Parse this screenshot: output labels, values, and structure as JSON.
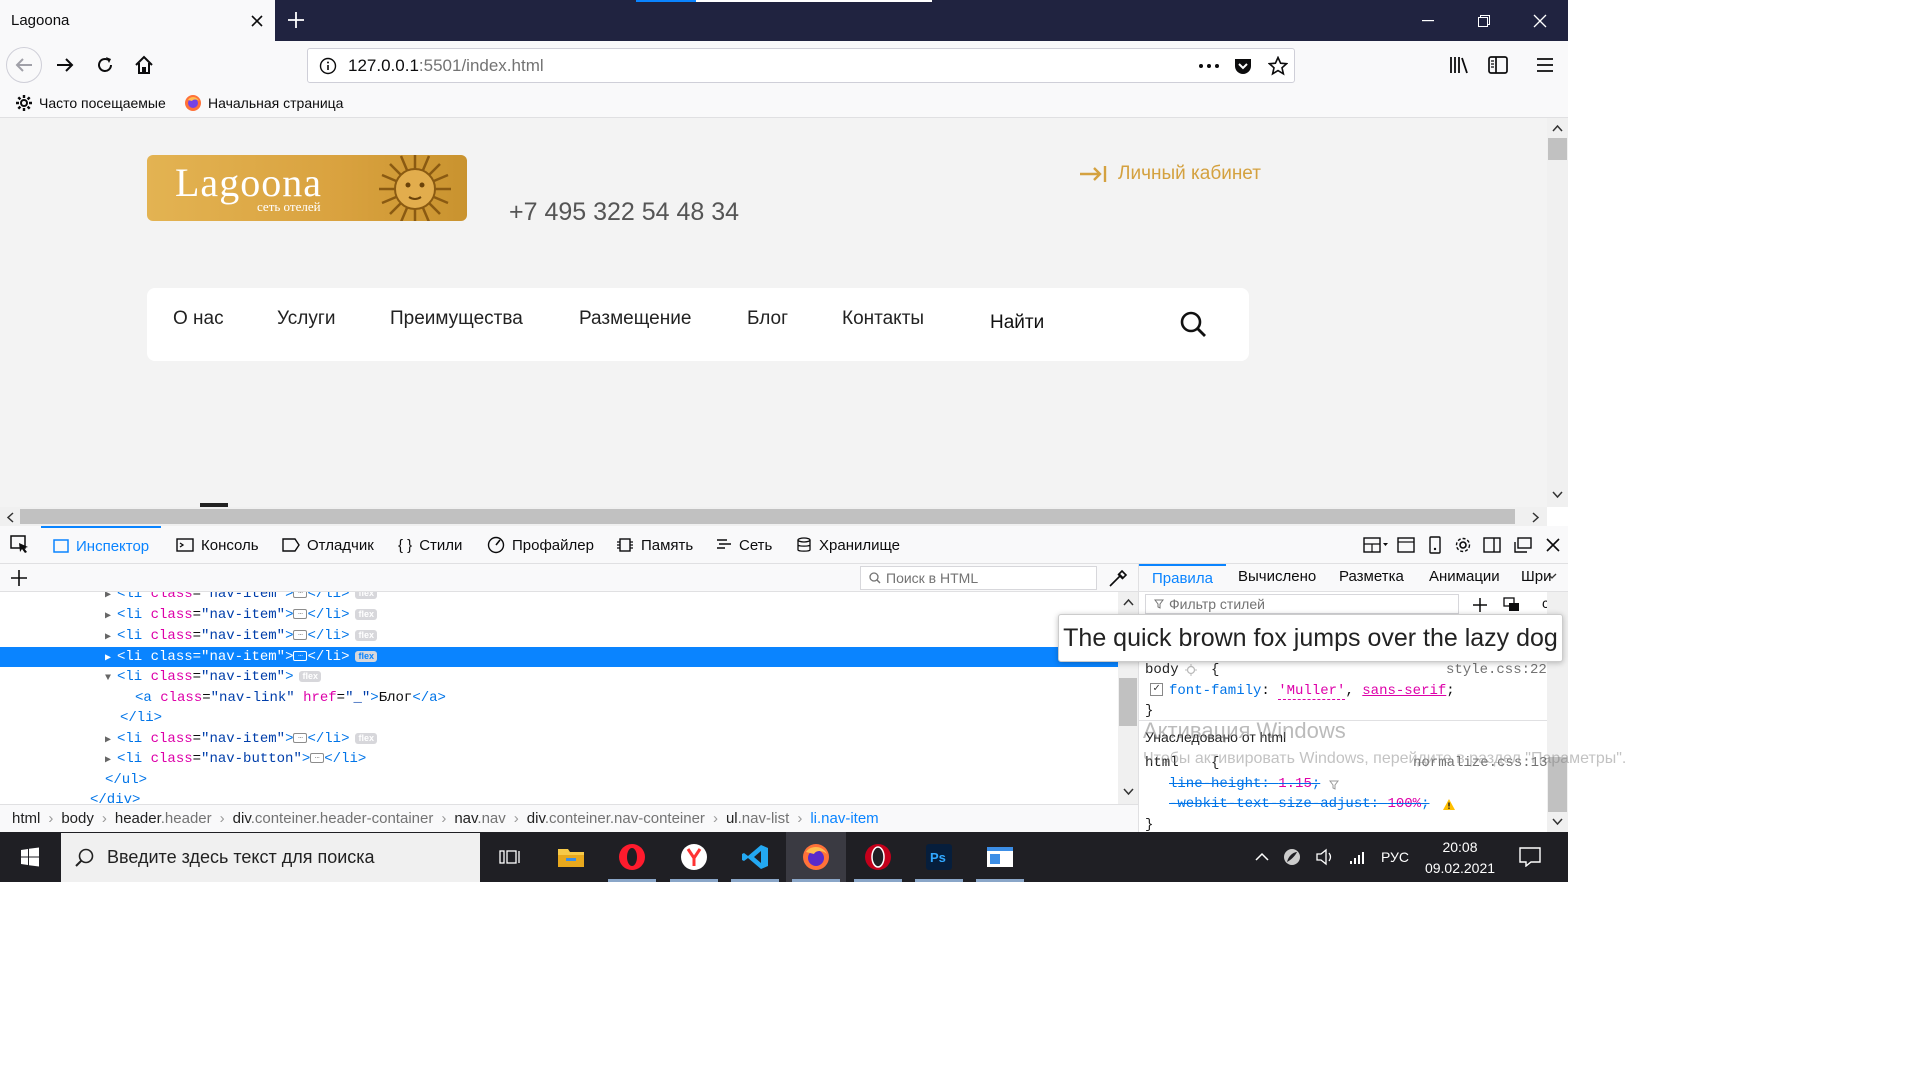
{
  "browser": {
    "tab_title": "Lagoona",
    "url_host": "127.0.0.1",
    "url_rest": ":5501/index.html",
    "bookmarks": [
      {
        "label": "Часто посещаемые",
        "icon": "gear-icon"
      },
      {
        "label": "Начальная страница",
        "icon": "firefox-icon"
      }
    ]
  },
  "page": {
    "logo_name": "Lagoona",
    "logo_sub": "сеть отелей",
    "phone": "+7 495 322 54 48 34",
    "cabinet": "Личный кабинет",
    "menu": [
      "О нас",
      "Услуги",
      "Преимущества",
      "Размещение",
      "Блог",
      "Контакты"
    ],
    "search_label": "Найти",
    "accent": "#d4a13f"
  },
  "devtools": {
    "tabs": [
      "Инспектор",
      "Консоль",
      "Отладчик",
      "Стили",
      "Профайлер",
      "Память",
      "Сеть",
      "Хранилище"
    ],
    "search_placeholder": "Поиск в HTML",
    "markup": {
      "line0": "<li class=\"nav-item\">",
      "line1_tag": "<li",
      "attr_class": "class",
      "val_nav_item": "\"nav-item\"",
      "val_nav_link": "\"nav-link\"",
      "val_nav_button": "\"nav-button\"",
      "attr_href": "href",
      "val_href": "\"_\"",
      "close_li": "</li>",
      "close_ul": "</ul>",
      "close_div": "</div>",
      "a_open": "<a",
      "a_text": "Блог",
      "a_close": "</a>",
      "flex_badge": "flex"
    },
    "breadcrumbs": [
      {
        "tag": "html",
        "cls": ""
      },
      {
        "tag": "body",
        "cls": ""
      },
      {
        "tag": "header",
        "cls": ".header"
      },
      {
        "tag": "div",
        "cls": ".conteiner.header-container"
      },
      {
        "tag": "nav",
        "cls": ".nav"
      },
      {
        "tag": "div",
        "cls": ".conteiner.nav-conteiner"
      },
      {
        "tag": "ul",
        "cls": ".nav-list"
      },
      {
        "tag": "li",
        "cls": ".nav-item"
      }
    ],
    "side_tabs": [
      "Правила",
      "Вычислено",
      "Разметка",
      "Анимации",
      "Шри"
    ],
    "filter_placeholder": "Фильтр стилей",
    "pseudo_btn": "cls",
    "tooltip": "The quick brown fox jumps over the lazy dog",
    "rules": {
      "sel1": "body",
      "src1": "style.css:22",
      "prop1": "font-family",
      "val1a": "'Muller'",
      "val1b": "sans-serif",
      "inherited": "Унаследовано от html",
      "sel2": "html",
      "src2": "normalize.css:13",
      "prop2": "line-height",
      "val2": "1.15",
      "prop3": "-webkit-text-size-adjust",
      "val3": "100%"
    },
    "watermark_title": "Активация Windows",
    "watermark_text": "Чтобы активировать Windows, перейдите в раздел \"Параметры\"."
  },
  "taskbar": {
    "search_placeholder": "Введите здесь текст для поиска",
    "lang": "РУС",
    "time": "20:08",
    "date": "09.02.2021",
    "apps": [
      "task-view-icon",
      "file-explorer-icon",
      "opera-icon",
      "yandex-browser-icon",
      "vscode-icon",
      "firefox-icon",
      "opera-gx-icon",
      "photoshop-icon",
      "app-window-icon"
    ]
  }
}
